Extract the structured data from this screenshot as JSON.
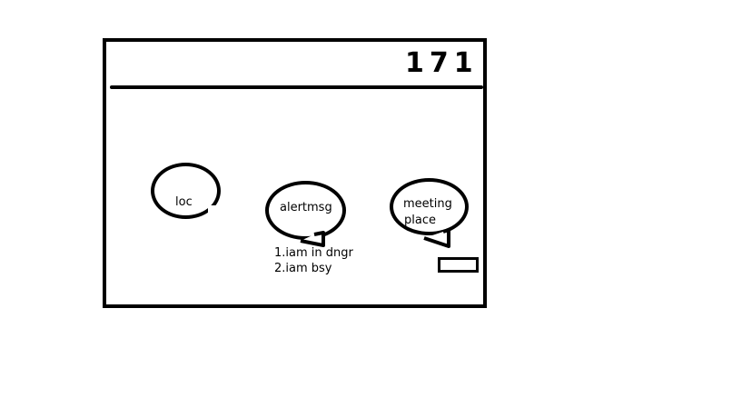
{
  "header": {
    "number": "171"
  },
  "buttons": {
    "loc": {
      "label": "loc"
    },
    "alertmsg": {
      "label": "alertmsg"
    },
    "meeting_place": {
      "line1": "meeting",
      "line2": "place"
    }
  },
  "alert_options": [
    "1.iam in dngr",
    "2.iam bsy"
  ]
}
